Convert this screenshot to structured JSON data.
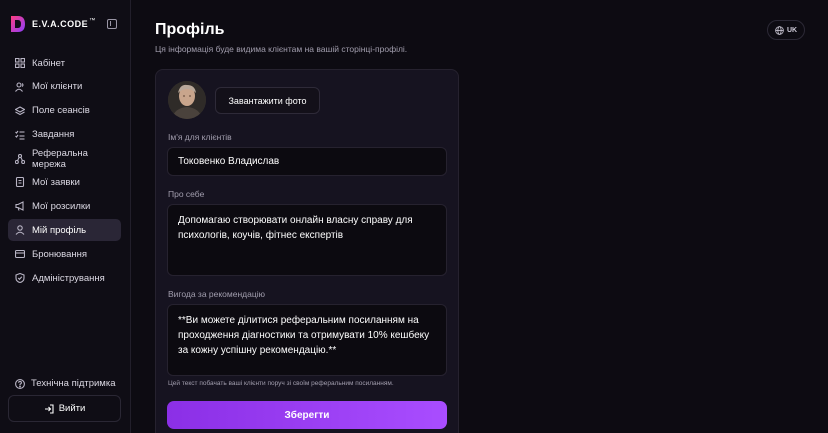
{
  "brand": {
    "name": "E.V.A.CODE",
    "mark": "™"
  },
  "sidebar": {
    "items": [
      {
        "label": "Кабінет",
        "icon": "grid-icon"
      },
      {
        "label": "Мої клієнти",
        "icon": "users-icon"
      },
      {
        "label": "Поле сеансів",
        "icon": "layers-icon"
      },
      {
        "label": "Завдання",
        "icon": "checklist-icon"
      },
      {
        "label": "Реферальна мережа",
        "icon": "network-icon"
      },
      {
        "label": "Мої заявки",
        "icon": "document-icon"
      },
      {
        "label": "Мої розсилки",
        "icon": "megaphone-icon"
      },
      {
        "label": "Мій профіль",
        "icon": "user-icon",
        "active": true
      },
      {
        "label": "Бронювання",
        "icon": "card-icon"
      },
      {
        "label": "Адміністрування",
        "icon": "shield-icon"
      }
    ],
    "support": "Технічна підтримка",
    "logout": "Вийти"
  },
  "header": {
    "title": "Профіль",
    "subtitle": "Ця інформація буде видима клієнтам на вашій сторінці-профілі.",
    "lang": "UK"
  },
  "form": {
    "upload_label": "Завантажити фото",
    "name_label": "Ім'я для клієнтів",
    "name_value": "Токовенко Владислав",
    "about_label": "Про себе",
    "about_value": "Допомагаю створювати онлайн власну справу для психологів, коучів, фітнес експертів",
    "benefit_label": "Вигода за рекомендацію",
    "benefit_value": "**Ви можете ділитися реферальним посиланням на проходження діагностики та отримувати 10% кешбеку за кожну успішну рекомендацію.**",
    "benefit_hint": "Цей текст побачать ваші клієнти поруч зі своїм реферальним посиланням.",
    "save_label": "Зберегти"
  },
  "colors": {
    "accent": "#9b3ff5",
    "background": "#0d0b12",
    "card": "#161320"
  }
}
